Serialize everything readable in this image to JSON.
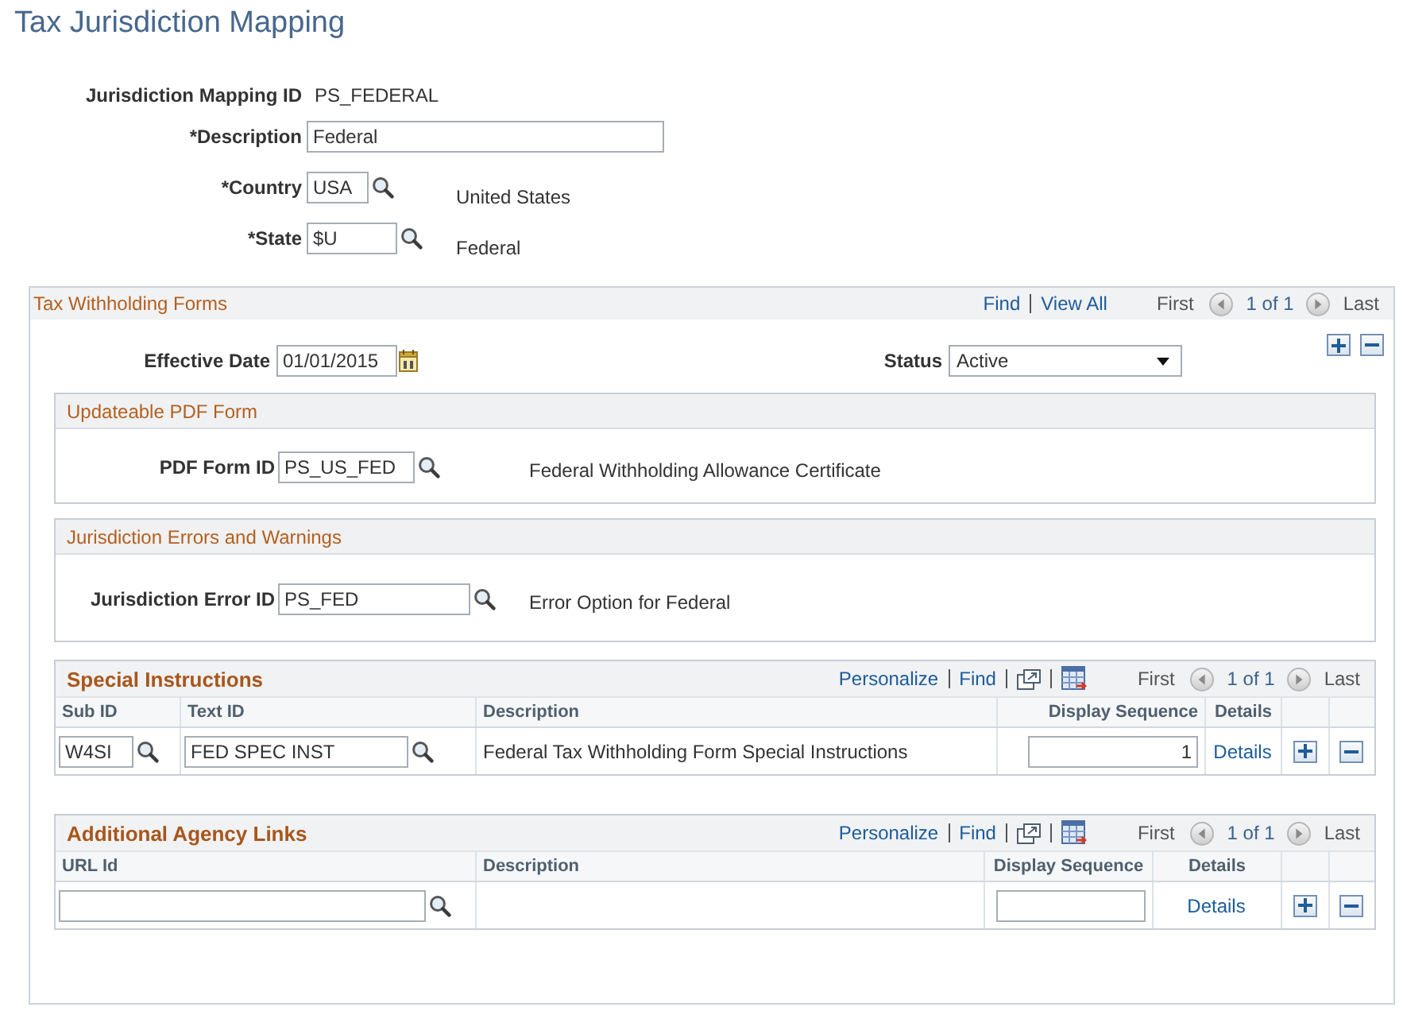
{
  "page_title": "Tax Jurisdiction Mapping",
  "header_fields": [
    {
      "kind": "display",
      "label": "Jurisdiction Mapping ID",
      "value": "PS_FEDERAL"
    },
    {
      "kind": "text",
      "label": "*Description",
      "value": "Federal"
    },
    {
      "kind": "lookup",
      "label": "*Country",
      "value": "USA",
      "description": "United States"
    },
    {
      "kind": "lookup",
      "label": "*State",
      "value": "$U",
      "description": "Federal"
    }
  ],
  "withholding_forms": {
    "title": "Tax Withholding Forms",
    "nav": {
      "links": [
        "Find",
        "View All"
      ],
      "first": "First",
      "count": "1 of 1",
      "last": "Last"
    },
    "effective_date": {
      "label": "Effective Date",
      "value": "01/01/2015"
    },
    "status": {
      "label": "Status",
      "value": "Active"
    },
    "sections": [
      {
        "title": "Updateable PDF Form",
        "field": {
          "label": "PDF Form ID",
          "value": "PS_US_FED",
          "description": "Federal Withholding Allowance Certificate"
        }
      },
      {
        "title": "Jurisdiction Errors and Warnings",
        "field": {
          "label": "Jurisdiction Error ID",
          "value": "PS_FED",
          "description": "Error Option for Federal"
        }
      }
    ],
    "grids": [
      {
        "title": "Special Instructions",
        "nav": {
          "links": [
            "Personalize",
            "Find"
          ],
          "first": "First",
          "count": "1 of 1",
          "last": "Last"
        },
        "columns": [
          {
            "label": "Sub ID"
          },
          {
            "label": "Text ID"
          },
          {
            "label": "Description"
          },
          {
            "label": "Display Sequence"
          },
          {
            "label": "Details"
          }
        ],
        "rows": [
          {
            "cells": [
              {
                "kind": "lookup",
                "value": "W4SI"
              },
              {
                "kind": "lookup",
                "value": "FED SPEC INST"
              },
              {
                "kind": "text",
                "value": "Federal Tax Withholding Form Special Instructions"
              },
              {
                "kind": "number",
                "value": "1"
              },
              {
                "kind": "link",
                "value": "Details"
              }
            ]
          }
        ]
      },
      {
        "title": "Additional Agency Links",
        "nav": {
          "links": [
            "Personalize",
            "Find"
          ],
          "first": "First",
          "count": "1 of 1",
          "last": "Last"
        },
        "columns": [
          {
            "label": "URL Id"
          },
          {
            "label": "Description"
          },
          {
            "label": "Display Sequence"
          },
          {
            "label": "Details"
          }
        ],
        "rows": [
          {
            "cells": [
              {
                "kind": "lookup"
              },
              {
                "kind": "text"
              },
              {
                "kind": "number"
              },
              {
                "kind": "link",
                "value": "Details"
              }
            ]
          }
        ]
      }
    ]
  }
}
